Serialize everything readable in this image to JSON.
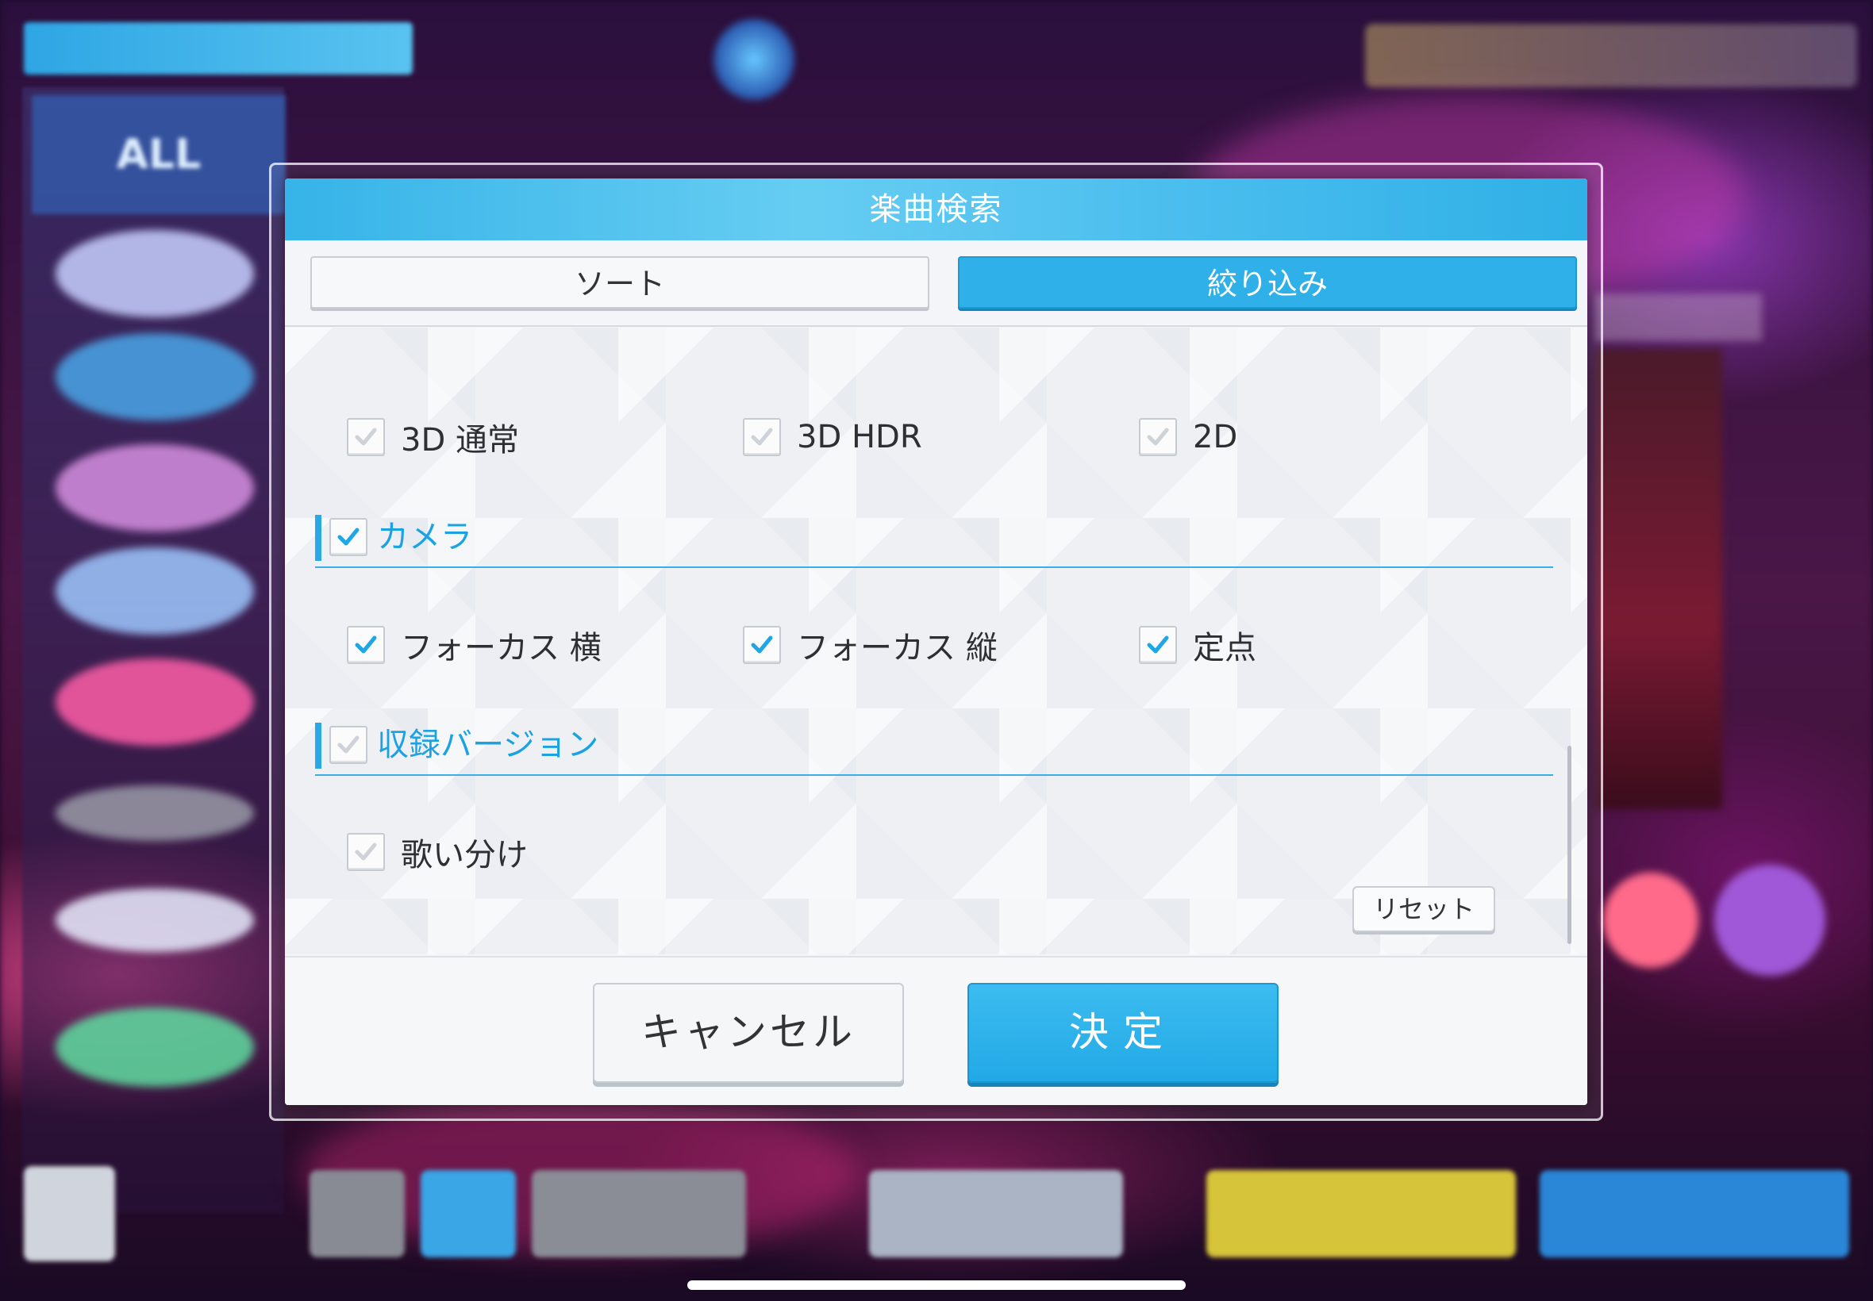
{
  "dialog": {
    "title": "楽曲検索",
    "tabs": [
      {
        "label": "ソート",
        "active": false
      },
      {
        "label": "絞り込み",
        "active": true
      }
    ],
    "display_options": [
      {
        "label": "3D 通常",
        "checked": true
      },
      {
        "label": "3D HDR",
        "checked": true
      },
      {
        "label": "2D",
        "checked": true
      }
    ],
    "camera_section": {
      "label": "カメラ",
      "checked": true
    },
    "camera_options": [
      {
        "label": "フォーカス 横",
        "checked": true
      },
      {
        "label": "フォーカス 縦",
        "checked": true
      },
      {
        "label": "定点",
        "checked": true
      }
    ],
    "version_section": {
      "label": "収録バージョン",
      "checked": false
    },
    "version_options": [
      {
        "label": "歌い分け",
        "checked": false
      }
    ],
    "reset_label": "リセット",
    "cancel_label": "キャンセル",
    "ok_label": "決定"
  },
  "background": {
    "sidebar_all": "ALL",
    "accent_color": "#2fb0e8"
  }
}
